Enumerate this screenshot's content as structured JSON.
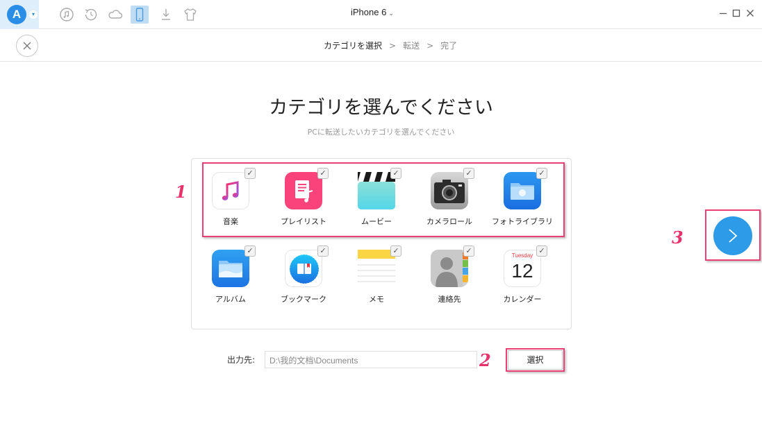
{
  "titlebar": {
    "device_name": "iPhone 6",
    "icons": [
      "app-logo-icon",
      "music-icon",
      "history-icon",
      "cloud-icon",
      "phone-icon",
      "download-icon",
      "tshirt-icon"
    ],
    "window_controls": [
      "minimize-icon",
      "maximize-icon",
      "close-icon"
    ]
  },
  "steps": {
    "step1": "カテゴリを選択",
    "step2": "転送",
    "step3": "完了",
    "separator": ">"
  },
  "main": {
    "title": "カテゴリを選んでください",
    "subtitle": "PCに転送したいカテゴリを選んでください"
  },
  "categories": [
    {
      "label": "音楽",
      "icon": "music-note-icon",
      "checked": true
    },
    {
      "label": "プレイリスト",
      "icon": "playlist-icon",
      "checked": true
    },
    {
      "label": "ムービー",
      "icon": "clapperboard-icon",
      "checked": true
    },
    {
      "label": "カメラロール",
      "icon": "camera-icon",
      "checked": true
    },
    {
      "label": "フォトライブラリ",
      "icon": "photo-folder-icon",
      "checked": true
    },
    {
      "label": "アルバム",
      "icon": "album-folder-icon",
      "checked": true
    },
    {
      "label": "ブックマーク",
      "icon": "safari-bookmark-icon",
      "checked": true
    },
    {
      "label": "メモ",
      "icon": "notes-icon",
      "checked": true
    },
    {
      "label": "連絡先",
      "icon": "contacts-icon",
      "checked": true
    },
    {
      "label": "カレンダー",
      "icon": "calendar-icon",
      "checked": true,
      "calendar_day": "Tuesday",
      "calendar_date": "12"
    }
  ],
  "output": {
    "label": "出力先:",
    "path": "D:\\我的文档\\Documents",
    "select_label": "選択"
  },
  "annotations": {
    "n1": "1",
    "n2": "2",
    "n3": "3",
    "color": "#ea3e74"
  },
  "colors": {
    "accent": "#2e9be8",
    "music_gradient": [
      "#fa2e6c",
      "#8e5cf2"
    ],
    "playlist": "#f9437a"
  }
}
